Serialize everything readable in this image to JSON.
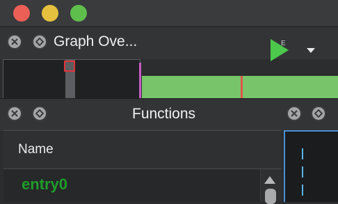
{
  "window": {
    "traffic_lights": [
      "close",
      "minimize",
      "zoom"
    ]
  },
  "graph_overview": {
    "title": "Graph Ove...",
    "run_button_badge": "E",
    "minimap_marker_color": "#e0343a",
    "strip_color": "#78c46a"
  },
  "functions_panel": {
    "title": "Functions",
    "columns": [
      "Name"
    ],
    "rows": [
      {
        "name": "entry0",
        "color": "#1f9c2a"
      }
    ]
  },
  "icons": {
    "dock_close": "close-circle-icon",
    "dock_float": "float-diamond-icon",
    "run": "play-icon",
    "dropdown": "chevron-down-icon",
    "scroll_up": "scroll-up-arrow-icon"
  }
}
